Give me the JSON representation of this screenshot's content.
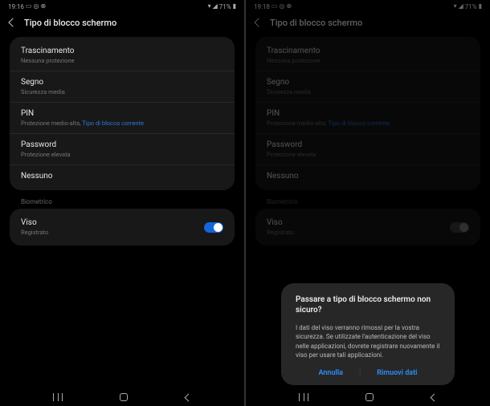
{
  "left": {
    "time": "19:16",
    "battery": "71%",
    "title": "Tipo di blocco schermo",
    "options": [
      {
        "title": "Trascinamento",
        "sub": "Nessuna protezione"
      },
      {
        "title": "Segno",
        "sub": "Sicurezza media"
      },
      {
        "title": "PIN",
        "sub_pre": "Protezione medio-alta, ",
        "sub_link": "Tipo di blocco corrente"
      },
      {
        "title": "Password",
        "sub": "Protezione elevata"
      },
      {
        "title": "Nessuno",
        "sub": ""
      }
    ],
    "biometric_header": "Biometrico",
    "face": {
      "title": "Viso",
      "sub": "Registrato"
    }
  },
  "right": {
    "time": "19:18",
    "battery": "71%",
    "title": "Tipo di blocco schermo",
    "options": [
      {
        "title": "Trascinamento",
        "sub": "Nessuna protezione"
      },
      {
        "title": "Segno",
        "sub": "Sicurezza media"
      },
      {
        "title": "PIN",
        "sub_pre": "Protezione medio-alta, ",
        "sub_link": "Tipo di blocco corrente"
      },
      {
        "title": "Password",
        "sub": "Protezione elevata"
      },
      {
        "title": "Nessuno",
        "sub": ""
      }
    ],
    "biometric_header": "Biometrico",
    "face": {
      "title": "Viso",
      "sub": "Registrato"
    },
    "dialog": {
      "title": "Passare a tipo di blocco schermo non sicuro?",
      "body": "I dati del viso verranno rimossi per la vostra sicurezza. Se utilizzate l'autenticazione del viso nelle applicazioni, dovrete registrare nuovamente il viso per usare tali applicazioni.",
      "cancel": "Annulla",
      "confirm": "Rimuovi dati"
    }
  }
}
